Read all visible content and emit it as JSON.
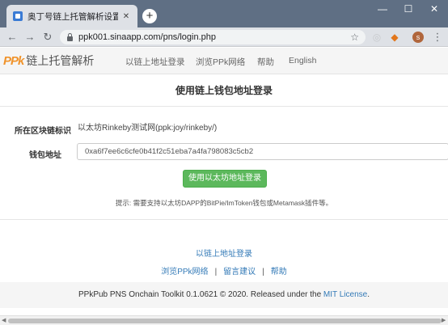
{
  "browser": {
    "tab_title": "奥丁号链上托管解析设置工具",
    "tab_close": "✕",
    "new_tab": "+",
    "url": "ppk001.sinaapp.com/pns/login.php",
    "profile_initial": "s",
    "window_minimize": "—",
    "window_maximize": "☐",
    "window_close": "✕",
    "back": "←",
    "forward": "→",
    "reload": "↻",
    "star": "☆",
    "menu": "⋮"
  },
  "site": {
    "logo": "PPk",
    "name": "链上托管解析",
    "nav": [
      "以链上地址登录",
      "浏览PPk网络",
      "帮助",
      "English"
    ]
  },
  "login": {
    "title": "使用链上钱包地址登录",
    "chain_label": "所在区块链标识",
    "chain_value": "以太坊Rinkeby测试网(ppk:joy/rinkeby/)",
    "wallet_label": "钱包地址",
    "wallet_value": "0xa6f7ee6c6cfe0b41f2c51eba7a4fa798083c5cb2",
    "submit": "使用以太坊地址登录",
    "hint": "提示: 需要支持以太坊DAPP的BitPie/ImToken钱包或Metamask插件等。"
  },
  "footer": {
    "login_link": "以链上地址登录",
    "links": [
      "浏览PPk网络",
      "留言建议",
      "帮助"
    ],
    "separator": "|",
    "copyright": "PPkPub PNS Onchain Toolkit 0.1.0621 © 2020. Released under the ",
    "license": "MIT License",
    "period": "."
  },
  "colors": {
    "accent_green": "#5cb85c",
    "link_blue": "#337ab7",
    "brand_orange": "#f0932b",
    "tabbar": "#5f6f84"
  },
  "icons": {
    "lock": "lock-icon",
    "star": "star-icon",
    "metamask": "metamask-extension-icon",
    "extension": "extension-icon"
  }
}
